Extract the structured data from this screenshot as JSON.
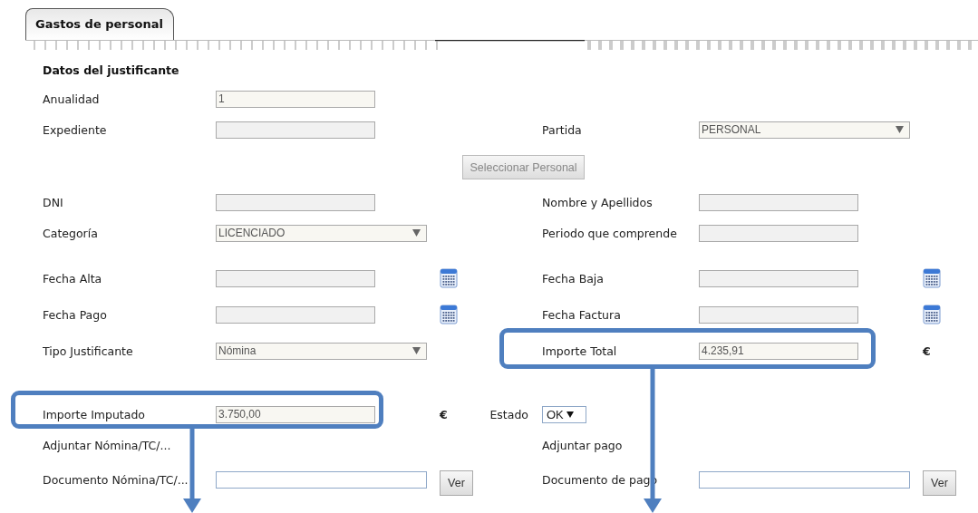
{
  "tab": {
    "label": "Gastos de personal",
    "selected": true
  },
  "section_title": "Datos del justificante",
  "rows": [
    {
      "left": {
        "label": "Anualidad",
        "control": {
          "kind": "field",
          "value": "1"
        }
      }
    },
    {
      "left": {
        "label": "Expediente",
        "control": {
          "kind": "field"
        }
      },
      "right": {
        "label": "Partida",
        "control": {
          "kind": "select",
          "value": "PERSONAL"
        }
      }
    },
    {
      "button": {
        "label": "Seleccionar Personal",
        "disabled": true
      }
    },
    {
      "left": {
        "label": "DNI",
        "control": {
          "kind": "field"
        }
      },
      "right": {
        "label": "Nombre y Apellidos",
        "control": {
          "kind": "field"
        }
      }
    },
    {
      "left": {
        "label": "Categoría",
        "control": {
          "kind": "select",
          "value": "LICENCIADO"
        }
      },
      "right": {
        "label": "Periodo que comprende",
        "control": {
          "kind": "field"
        }
      }
    },
    {
      "left": {
        "label": "Fecha Alta",
        "control": {
          "kind": "field"
        },
        "extra": {
          "kind": "calendar"
        }
      },
      "right": {
        "label": "Fecha Baja",
        "control": {
          "kind": "field"
        },
        "extra": {
          "kind": "calendar"
        }
      }
    },
    {
      "left": {
        "label": "Fecha Pago",
        "control": {
          "kind": "field"
        },
        "extra": {
          "kind": "calendar"
        }
      },
      "right": {
        "label": "Fecha Factura",
        "control": {
          "kind": "field"
        },
        "extra": {
          "kind": "calendar"
        }
      }
    },
    {
      "left": {
        "label": "Tipo Justificante",
        "control": {
          "kind": "select",
          "value": "Nómina"
        }
      },
      "right": {
        "label": "Importe Total",
        "control": {
          "kind": "field",
          "value": "4.235,91"
        },
        "extra": {
          "kind": "unit",
          "text": "€"
        },
        "highlighted": true
      }
    },
    {
      "left": {
        "label": "Importe Imputado",
        "control": {
          "kind": "field",
          "value": "3.750,00"
        },
        "extra": {
          "kind": "unit",
          "text": "€"
        },
        "highlighted": true
      },
      "status": {
        "label": "Estado",
        "value": "OK"
      }
    },
    {
      "left": {
        "label": "Adjuntar Nómina/TC/..."
      },
      "right": {
        "label": "Adjuntar pago"
      }
    },
    {
      "left": {
        "label": "Documento Nómina/TC/...",
        "control": {
          "kind": "file-field"
        },
        "extra": {
          "kind": "button",
          "text": "Ver"
        }
      },
      "right": {
        "label": "Documento de pago",
        "control": {
          "kind": "file-field"
        },
        "extra": {
          "kind": "button",
          "text": "Ver"
        }
      }
    }
  ]
}
